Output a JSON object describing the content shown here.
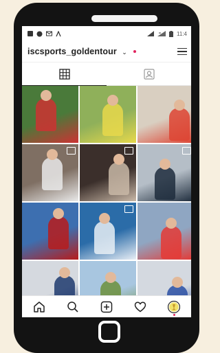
{
  "status_bar": {
    "time": "11:4",
    "left_icons": [
      "sim-icon",
      "messenger-icon",
      "mail-icon",
      "android-icon"
    ],
    "right_icons": [
      "signal-icon",
      "wifi-icon",
      "battery-icon"
    ]
  },
  "header": {
    "username": "iscsports_goldentour",
    "notification_dot_color": "#e0245e"
  },
  "tabs": [
    {
      "name": "grid-tab",
      "icon": "grid-icon",
      "active": true
    },
    {
      "name": "tagged-tab",
      "icon": "tagged-icon",
      "active": false
    }
  ],
  "posts": [
    {
      "palette": "#4a7a3a",
      "accent": "#c33",
      "multi": false
    },
    {
      "palette": "#8fb05a",
      "accent": "#e7d84b",
      "multi": false
    },
    {
      "palette": "#d9cfc1",
      "accent": "#d43",
      "multi": false
    },
    {
      "palette": "#7f6f63",
      "accent": "#e9e9e9",
      "multi": true
    },
    {
      "palette": "#3b2f2b",
      "accent": "#c9b8a7",
      "multi": true
    },
    {
      "palette": "#b5bec7",
      "accent": "#1f2d3d",
      "multi": true
    },
    {
      "palette": "#3d6fb0",
      "accent": "#b71c1c",
      "multi": false
    },
    {
      "palette": "#2b6ca8",
      "accent": "#e8eef5",
      "multi": true
    },
    {
      "palette": "#8fa6c2",
      "accent": "#e53935",
      "multi": false
    },
    {
      "palette": "#d5d9df",
      "accent": "#1e3a6e",
      "multi": false
    },
    {
      "palette": "#a8c6e0",
      "accent": "#6c8f3b",
      "multi": false
    },
    {
      "palette": "#d4d9e0",
      "accent": "#2a4fa3",
      "multi": false
    }
  ],
  "bottom_nav": [
    {
      "name": "nav-home",
      "icon": "home-icon"
    },
    {
      "name": "nav-search",
      "icon": "search-icon"
    },
    {
      "name": "nav-add",
      "icon": "add-post-icon"
    },
    {
      "name": "nav-activity",
      "icon": "heart-icon"
    },
    {
      "name": "nav-profile",
      "icon": "profile-avatar-icon"
    }
  ]
}
